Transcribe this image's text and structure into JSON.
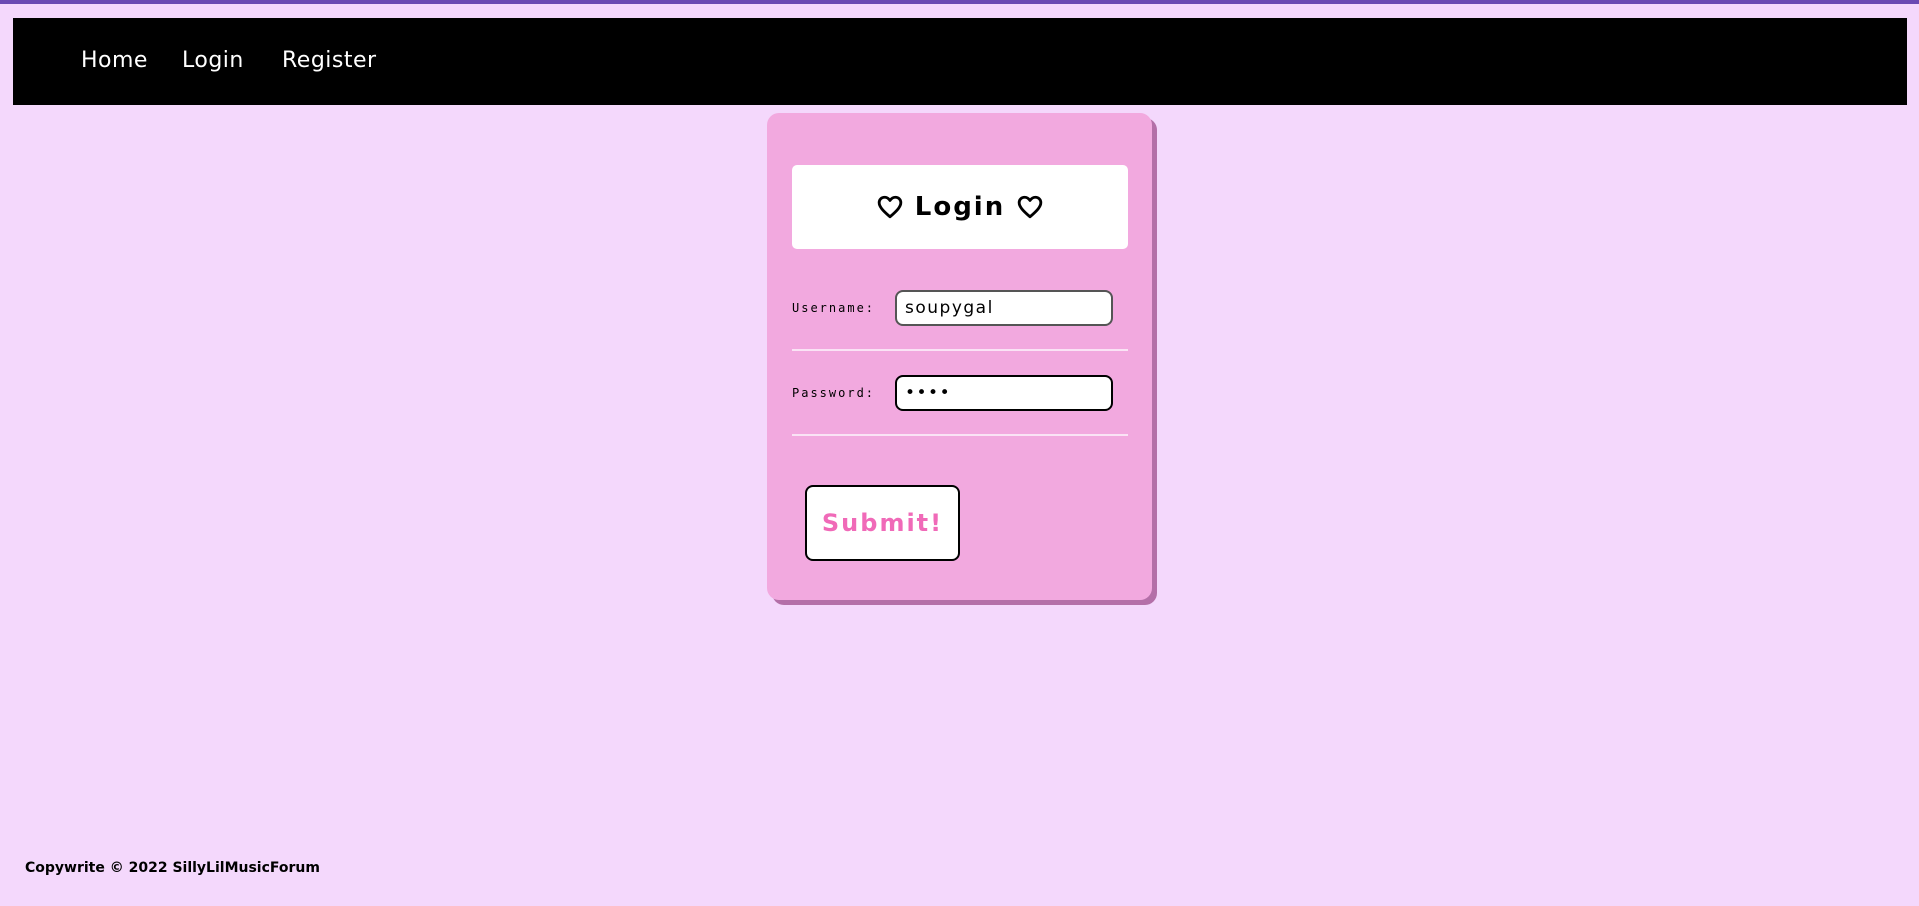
{
  "nav": {
    "links": [
      {
        "label": "Home"
      },
      {
        "label": "Login"
      },
      {
        "label": "Register"
      }
    ]
  },
  "login_card": {
    "title": "Login",
    "username": {
      "label": "Username:",
      "value": "soupygal"
    },
    "password": {
      "label": "Password:",
      "value": "••••"
    },
    "submit_label": "Submit!"
  },
  "footer": {
    "text": "Copywrite © 2022 SillyLilMusicForum"
  },
  "colors": {
    "page_background": "#f4d8fc",
    "top_strip": "#6a4ab3",
    "navbar": "#000000",
    "card": "#f2a9df",
    "card_shadow": "#b46fa8",
    "submit_text": "#f06ab8"
  },
  "icons": {
    "title_left": "heart-outline-icon",
    "title_right": "heart-outline-icon"
  }
}
